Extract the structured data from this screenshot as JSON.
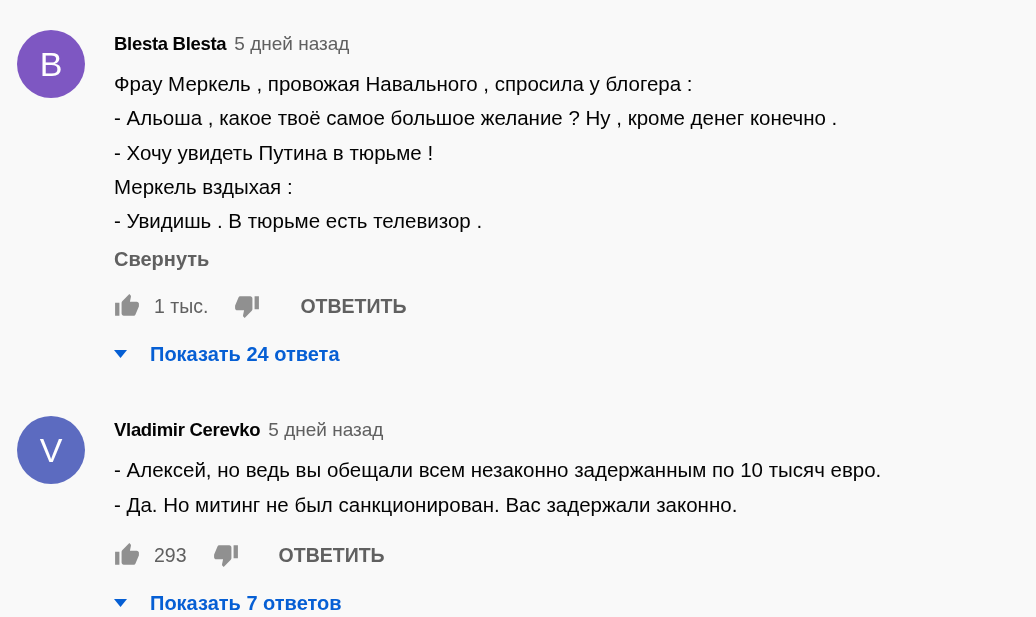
{
  "comments": [
    {
      "avatar_letter": "B",
      "color": "#7e57c2",
      "author": "Blesta Blesta",
      "time": "5 дней назад",
      "lines": [
        "Фрау Меркель , провожая Навального , спросила у блогера :",
        "- Альоша , какое твоё самое большое желание ? Ну , кроме денег конечно .",
        "- Хочу увидеть Путина в тюрьме !",
        "Меркель вздыхая :",
        "- Увидишь . В тюрьме есть телевизор ."
      ],
      "collapse_label": "Свернуть",
      "likes": "1 тыс.",
      "reply_label": "ОТВЕТИТЬ",
      "replies_label": "Показать 24 ответа"
    },
    {
      "avatar_letter": "V",
      "color": "#5c6bc0",
      "author": "Vladimir Cerevko",
      "time": "5 дней назад",
      "lines": [
        "- Алексей, но ведь вы обещали всем незаконно задержанным по 10 тысяч евро.",
        "- Да. Но митинг не был санкционирован. Вас задержали законно."
      ],
      "likes": "293",
      "reply_label": "ОТВЕТИТЬ",
      "replies_label": "Показать 7 ответов"
    }
  ]
}
